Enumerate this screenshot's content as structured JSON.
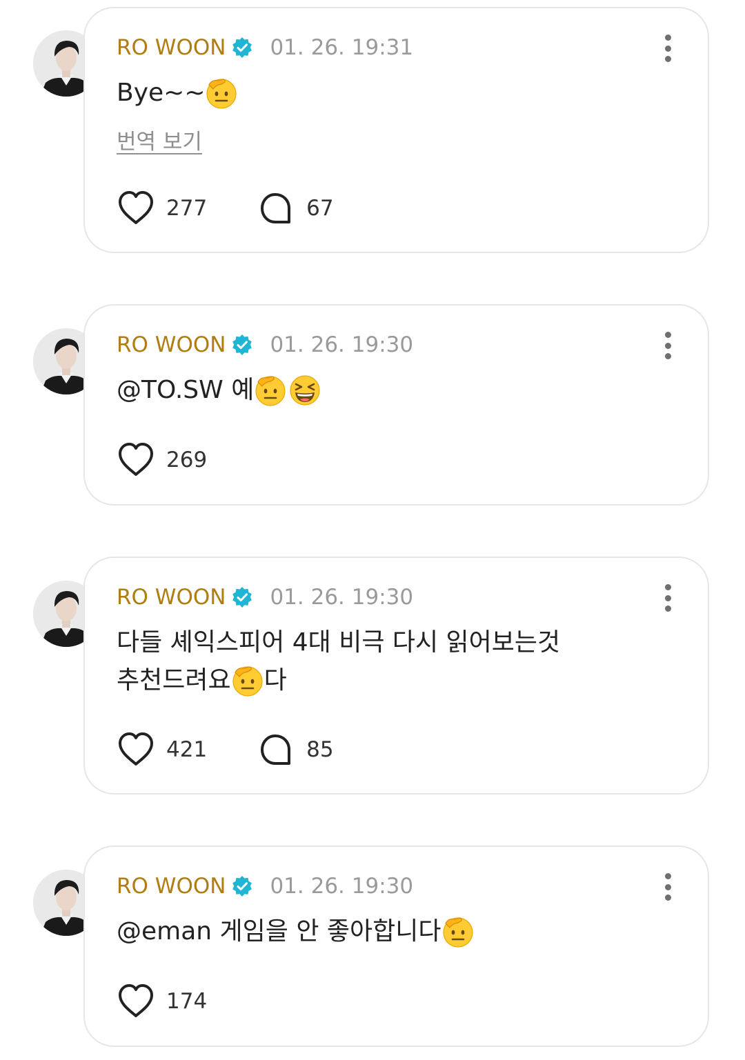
{
  "posts": [
    {
      "author": "RO WOON",
      "verified": true,
      "timestamp": "01. 26. 19:31",
      "text_parts": [
        "Bye~~"
      ],
      "emojis": [
        "salute"
      ],
      "translate_label": "번역 보기",
      "likes": "277",
      "comments": "67"
    },
    {
      "author": "RO WOON",
      "verified": true,
      "timestamp": "01. 26. 19:30",
      "text_parts": [
        "@TO.SW 예"
      ],
      "emojis": [
        "salute",
        "laughing-squint"
      ],
      "likes": "269"
    },
    {
      "author": "RO WOON",
      "verified": true,
      "timestamp": "01. 26. 19:30",
      "text_parts": [
        "다들 셰익스피어 4대 비극 다시 읽어보는것",
        "추천드려요",
        "다"
      ],
      "emojis": [
        "salute"
      ],
      "likes": "421",
      "comments": "85"
    },
    {
      "author": "RO WOON",
      "verified": true,
      "timestamp": "01. 26. 19:30",
      "text_parts": [
        "@eman 게임을 안 좋아합니다"
      ],
      "emojis": [
        "salute"
      ],
      "likes": "174"
    }
  ],
  "icons": {
    "like": "heart-outline-icon",
    "comment": "speech-bubble-outline-icon",
    "more": "vertical-ellipsis-icon",
    "verified": "verified-badge-icon"
  },
  "colors": {
    "author_name": "#b07d10",
    "timestamp": "#9a9a9a",
    "verified_badge": "#1fb6d6",
    "card_border": "#e6e6e6"
  }
}
